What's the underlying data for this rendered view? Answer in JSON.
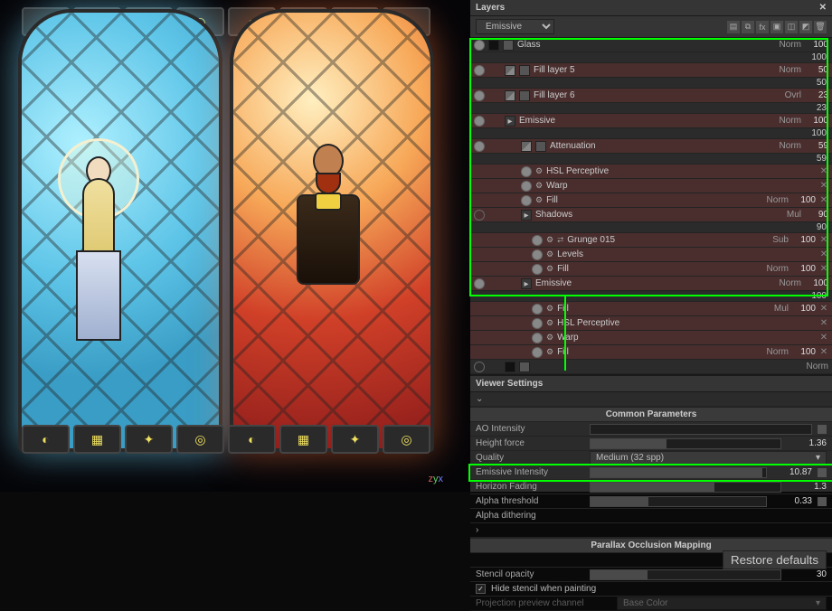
{
  "viewport": {
    "gizmo": {
      "z": "z",
      "y": "y",
      "x": "x"
    }
  },
  "layers_panel": {
    "title": "Layers",
    "channel": "Emissive",
    "close_glyph": "✕",
    "tool_icons": [
      "file-icon",
      "copy-icon",
      "fx-icon",
      "folder-icon",
      "add-layer-icon",
      "add-fill-icon",
      "trash-icon"
    ],
    "rows": [
      {
        "kind": "layer",
        "name": "Glass",
        "thumb": "mask",
        "blend": "Norm",
        "op": 100,
        "indent": 0,
        "eye": true
      },
      {
        "kind": "layer",
        "name": "Fill layer 5",
        "thumb": "fill",
        "blend": "Norm",
        "op": 50,
        "indent": 1,
        "eye": true,
        "sel": true
      },
      {
        "kind": "layer",
        "name": "Fill layer 6",
        "thumb": "fill",
        "blend": "Ovrl",
        "op": 23,
        "indent": 1,
        "eye": true,
        "sel": true
      },
      {
        "kind": "folder",
        "name": "Emissive",
        "blend": "Norm",
        "op": 100,
        "indent": 1,
        "eye": true,
        "sel": true
      },
      {
        "kind": "layer",
        "name": "Attenuation",
        "thumb": "fill",
        "blend": "Norm",
        "op": 59,
        "indent": 2,
        "eye": true,
        "sel": true
      },
      {
        "kind": "eff",
        "name": "HSL Perceptive",
        "x": true,
        "sel": true,
        "eye": true
      },
      {
        "kind": "eff",
        "name": "Warp",
        "x": true,
        "sel": true,
        "eye": true
      },
      {
        "kind": "eff",
        "name": "Fill",
        "blend": "Norm",
        "op": 100,
        "x": true,
        "sel": true,
        "eye": true
      },
      {
        "kind": "folder",
        "name": "Shadows",
        "blend": "Mul",
        "op": 90,
        "indent": 2,
        "eye": false,
        "sel": true
      },
      {
        "kind": "eff2",
        "name": "Grunge 015",
        "link": true,
        "blend": "Sub",
        "op": 100,
        "x": true,
        "sel": true,
        "eye": true
      },
      {
        "kind": "eff2",
        "name": "Levels",
        "x": true,
        "sel": true,
        "eye": true
      },
      {
        "kind": "eff2",
        "name": "Fill",
        "blend": "Norm",
        "op": 100,
        "x": true,
        "sel": true,
        "eye": true
      },
      {
        "kind": "folder",
        "name": "Emissive",
        "blend": "Norm",
        "op": 100,
        "indent": 2,
        "eye": true,
        "sel": true
      },
      {
        "kind": "eff2",
        "name": "Fill",
        "blend": "Mul",
        "op": 100,
        "x": true,
        "sel": true,
        "eye": true
      },
      {
        "kind": "eff2",
        "name": "HSL Perceptive",
        "x": true,
        "sel": true,
        "eye": true
      },
      {
        "kind": "eff2",
        "name": "Warp",
        "x": true,
        "sel": true,
        "eye": true
      },
      {
        "kind": "eff2",
        "name": "Fill",
        "blend": "Norm",
        "op": 100,
        "x": true,
        "sel": true,
        "eye": true
      },
      {
        "kind": "layer",
        "name": "",
        "thumb": "mask",
        "blend": "Norm",
        "op": "",
        "indent": 1,
        "eye": false
      }
    ]
  },
  "viewer": {
    "title": "Viewer Settings",
    "common": {
      "head": "Common Parameters",
      "ao_label": "AO Intensity",
      "height_label": "Height force",
      "height_val": 1.36,
      "height_fill": 40,
      "quality_label": "Quality",
      "quality_val": "Medium (32 spp)",
      "emissive_label": "Emissive Intensity",
      "emissive_val": 10.87,
      "emissive_fill": 98,
      "horizon_label": "Horizon Fading",
      "horizon_val": 1.3,
      "horizon_fill": 65,
      "alphat_label": "Alpha threshold",
      "alphat_val": 0.33,
      "alphat_fill": 33,
      "alphad_label": "Alpha dithering"
    },
    "parallax": {
      "head": "Parallax Occlusion Mapping",
      "restore": "Restore defaults"
    },
    "stencil": {
      "opacity_label": "Stencil opacity",
      "opacity_val": 30,
      "opacity_fill": 30,
      "hide_label": "Hide stencil when painting",
      "proj_label": "Projection preview channel",
      "proj_val": "Base Color"
    }
  },
  "glyphs": {
    "eye": "◉",
    "link": "⮂",
    "fx": "⚙"
  }
}
